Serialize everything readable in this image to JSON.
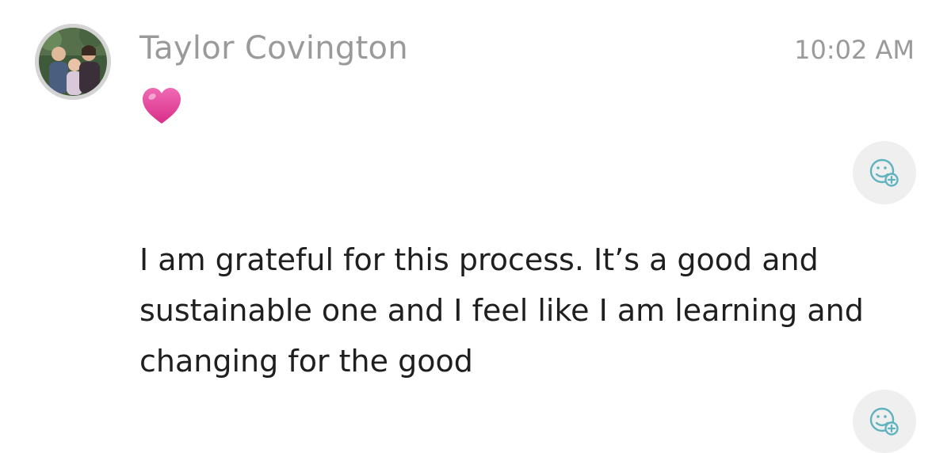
{
  "message": {
    "sender_name": "Taylor Covington",
    "timestamp": "10:02 AM",
    "reaction_emoji": "pink-heart",
    "text": "I am grateful for this process. It’s a good and sustainable one and I feel like I am learning and changing for the good"
  },
  "icons": {
    "add_reaction": "smiley-plus-icon"
  },
  "colors": {
    "name_gray": "#9a9a9a",
    "text": "#1f1f1f",
    "heart": "#e6409a",
    "icon_teal": "#4fb3c0",
    "button_bg": "#efefef"
  }
}
